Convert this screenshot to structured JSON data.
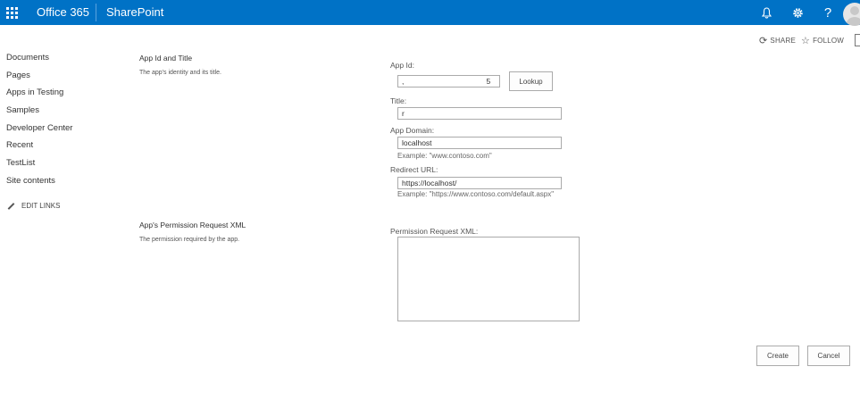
{
  "suite_bar": {
    "brand": "Office 365",
    "app": "SharePoint",
    "icons": [
      "app-launcher-icon",
      "bell-icon",
      "gear-icon",
      "help-icon",
      "avatar"
    ],
    "help_glyph": "?",
    "color": "#0072c6"
  },
  "actions": {
    "share": "SHARE",
    "follow": "FOLLOW"
  },
  "nav": {
    "items": [
      "Documents",
      "Pages",
      "Apps in Testing",
      "Samples",
      "Developer Center",
      "Recent",
      "TestList",
      "Site contents"
    ],
    "edit_links": "EDIT LINKS"
  },
  "sections": {
    "app_id": {
      "title": "App Id and Title",
      "description": "The app's identity and its title."
    },
    "permission": {
      "title": "App's Permission Request XML",
      "description": "The permission required by the app."
    }
  },
  "form": {
    "app_id_label": "App Id:",
    "app_id_value": ",                                       5",
    "lookup_label": "Lookup",
    "title_label": "Title:",
    "title_value": "r",
    "app_domain_label": "App Domain:",
    "app_domain_value": "localhost",
    "app_domain_example": "Example: \"www.contoso.com\"",
    "redirect_label": "Redirect URL:",
    "redirect_value": "https://localhost/",
    "redirect_example": "Example: \"https://www.contoso.com/default.aspx\"",
    "permission_label": "Permission Request XML:",
    "permission_value": ""
  },
  "buttons": {
    "create": "Create",
    "cancel": "Cancel"
  }
}
